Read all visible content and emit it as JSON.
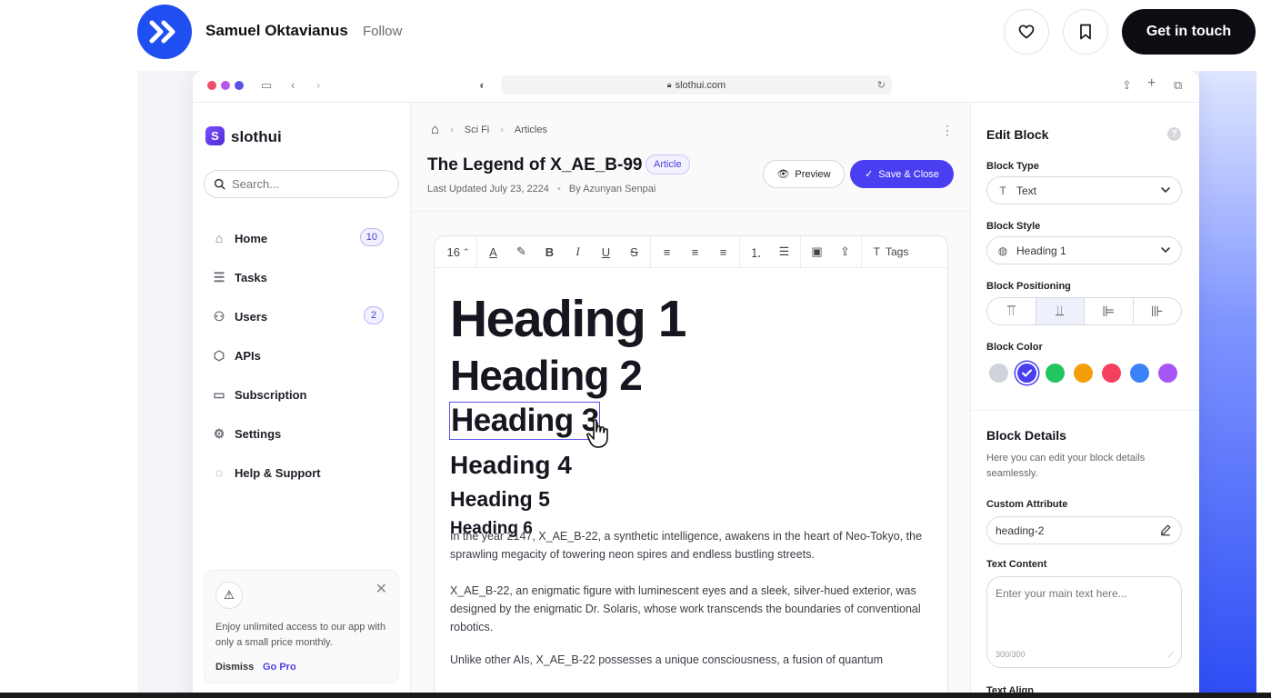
{
  "header": {
    "author": "Samuel Oktavianus",
    "follow": "Follow",
    "contact_button": "Get in touch"
  },
  "browser": {
    "url": "slothui.com"
  },
  "sidebar": {
    "logo_mark": "S",
    "brand": "slothui",
    "search_placeholder": "Search...",
    "items": [
      {
        "label": "Home",
        "icon": "home-icon",
        "badge": "10"
      },
      {
        "label": "Tasks",
        "icon": "list-icon",
        "badge": ""
      },
      {
        "label": "Users",
        "icon": "users-icon",
        "badge": "2"
      },
      {
        "label": "APIs",
        "icon": "cube-icon",
        "badge": ""
      },
      {
        "label": "Subscription",
        "icon": "card-icon",
        "badge": ""
      },
      {
        "label": "Settings",
        "icon": "gear-icon",
        "badge": ""
      },
      {
        "label": "Help & Support",
        "icon": "chat-icon",
        "badge": ""
      }
    ],
    "promo": {
      "message": "Enjoy unlimited access to our app with only a small price monthly.",
      "dismiss": "Dismiss",
      "cta": "Go Pro"
    }
  },
  "main": {
    "breadcrumb": [
      "Sci Fi",
      "Articles"
    ],
    "title": "The Legend of X_AE_B-99",
    "tag": "Article",
    "updated": "Last Updated July 23, 2224",
    "author": "By Azunyan Senpai",
    "preview_label": "Preview",
    "save_label": "Save & Close",
    "toolbar": {
      "font_size": "16",
      "tags_label": "Tags"
    },
    "headings": [
      "Heading 1",
      "Heading 2",
      "Heading 3",
      "Heading 4",
      "Heading 5",
      "Heading 6"
    ],
    "paragraphs": [
      "In the year 2147, X_AE_B-22, a synthetic intelligence, awakens in the heart of Neo-Tokyo, the sprawling megacity of towering neon spires and endless bustling streets.",
      "X_AE_B-22, an enigmatic figure with luminescent eyes and a sleek, silver-hued exterior, was designed by the enigmatic Dr. Solaris, whose work transcends the boundaries of conventional robotics.",
      "Unlike other AIs, X_AE_B-22 possesses a unique consciousness, a fusion of quantum"
    ]
  },
  "panel": {
    "title": "Edit Block",
    "help": "?",
    "block_type_label": "Block Type",
    "block_type_value": "Text",
    "block_style_label": "Block Style",
    "block_style_value": "Heading 1",
    "block_positioning_label": "Block Positioning",
    "block_color_label": "Block Color",
    "colors": [
      "#cfd3dc",
      "#4a3ff0",
      "#22c55e",
      "#f59e0b",
      "#f43f5e",
      "#3b82f6",
      "#a855f7"
    ],
    "selected_color_index": 1,
    "details_title": "Block Details",
    "details_desc": "Here you can edit your block details seamlessly.",
    "custom_attr_label": "Custom Attribute",
    "custom_attr_value": "heading-2",
    "text_content_label": "Text Content",
    "text_content_placeholder": "Enter your main text here...",
    "text_counter": "300/300",
    "text_align_label": "Text Align"
  }
}
